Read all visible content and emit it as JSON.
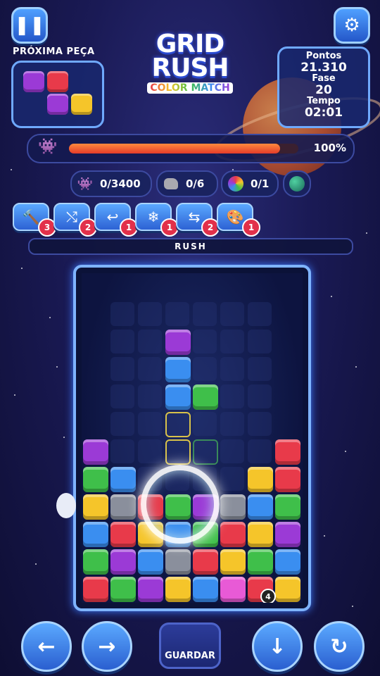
{
  "header": {
    "pause_icon": "pause-icon",
    "settings_icon": "gear-icon",
    "next_piece_label": "PRÓXIMA PEÇA",
    "logo_line1": "GRID",
    "logo_line2": "RUSH",
    "logo_sub": "COLOR MATCH"
  },
  "next_piece": {
    "blocks": [
      {
        "col": 0,
        "row": 0,
        "color": "#9b3ad6"
      },
      {
        "col": 1,
        "row": 0,
        "color": "#e83a4a"
      },
      {
        "col": 1,
        "row": 1,
        "color": "#9b3ad6"
      },
      {
        "col": 2,
        "row": 1,
        "color": "#f5c52a"
      }
    ]
  },
  "score": {
    "points_label": "Pontos",
    "points_value": "21.310",
    "phase_label": "Fase",
    "phase_value": "20",
    "time_label": "Tempo",
    "time_value": "02:01"
  },
  "progress": {
    "icon": "space-invader-icon",
    "value": 0.92,
    "text": "100%"
  },
  "goals": [
    {
      "icon": "space-invader-icon",
      "text": "0/3400"
    },
    {
      "icon": "rock-icon",
      "text": "0/6"
    },
    {
      "icon": "color-wheel-icon",
      "text": "0/1"
    },
    {
      "icon": "planet-icon",
      "text": ""
    }
  ],
  "tools": [
    {
      "icon": "hammer-icon",
      "glyph": "🔨",
      "count": "3"
    },
    {
      "icon": "shuffle-icon",
      "glyph": "⤭",
      "count": "2"
    },
    {
      "icon": "undo-icon",
      "glyph": "↩",
      "count": "1"
    },
    {
      "icon": "snowflake-icon",
      "glyph": "❄",
      "count": "1"
    },
    {
      "icon": "swap-icon",
      "glyph": "⇆",
      "count": "2"
    },
    {
      "icon": "palette-icon",
      "glyph": "🎨",
      "count": "1"
    }
  ],
  "rush_label": "RUSH",
  "board": {
    "colors": {
      "P": "#9b3ad6",
      "B": "#3a8ef0",
      "G": "#3fbf4a",
      "Y": "#f5c52a",
      "R": "#e83a4a",
      "S": "#8a8f9c",
      "M": "#e85ad6"
    },
    "blocks": [
      {
        "c": 3,
        "r": 2,
        "k": "P"
      },
      {
        "c": 3,
        "r": 3,
        "k": "B"
      },
      {
        "c": 3,
        "r": 4,
        "k": "B"
      },
      {
        "c": 4,
        "r": 4,
        "k": "G"
      },
      {
        "c": 0,
        "r": 6,
        "k": "P"
      },
      {
        "c": 7,
        "r": 6,
        "k": "R"
      },
      {
        "c": 0,
        "r": 7,
        "k": "G"
      },
      {
        "c": 1,
        "r": 7,
        "k": "B"
      },
      {
        "c": 6,
        "r": 7,
        "k": "Y"
      },
      {
        "c": 7,
        "r": 7,
        "k": "R"
      },
      {
        "c": 0,
        "r": 8,
        "k": "Y"
      },
      {
        "c": 1,
        "r": 8,
        "k": "S"
      },
      {
        "c": 2,
        "r": 8,
        "k": "R"
      },
      {
        "c": 3,
        "r": 8,
        "k": "G"
      },
      {
        "c": 4,
        "r": 8,
        "k": "P"
      },
      {
        "c": 5,
        "r": 8,
        "k": "S"
      },
      {
        "c": 6,
        "r": 8,
        "k": "B"
      },
      {
        "c": 7,
        "r": 8,
        "k": "G"
      },
      {
        "c": 0,
        "r": 9,
        "k": "B"
      },
      {
        "c": 1,
        "r": 9,
        "k": "R"
      },
      {
        "c": 2,
        "r": 9,
        "k": "Y"
      },
      {
        "c": 3,
        "r": 9,
        "k": "B"
      },
      {
        "c": 4,
        "r": 9,
        "k": "G"
      },
      {
        "c": 5,
        "r": 9,
        "k": "R"
      },
      {
        "c": 6,
        "r": 9,
        "k": "Y"
      },
      {
        "c": 7,
        "r": 9,
        "k": "P"
      },
      {
        "c": 0,
        "r": 10,
        "k": "G"
      },
      {
        "c": 1,
        "r": 10,
        "k": "P"
      },
      {
        "c": 2,
        "r": 10,
        "k": "B"
      },
      {
        "c": 3,
        "r": 10,
        "k": "S"
      },
      {
        "c": 4,
        "r": 10,
        "k": "R"
      },
      {
        "c": 5,
        "r": 10,
        "k": "Y"
      },
      {
        "c": 6,
        "r": 10,
        "k": "G"
      },
      {
        "c": 7,
        "r": 10,
        "k": "B"
      },
      {
        "c": 0,
        "r": 11,
        "k": "R"
      },
      {
        "c": 1,
        "r": 11,
        "k": "G"
      },
      {
        "c": 2,
        "r": 11,
        "k": "P"
      },
      {
        "c": 3,
        "r": 11,
        "k": "Y"
      },
      {
        "c": 4,
        "r": 11,
        "k": "B"
      },
      {
        "c": 5,
        "r": 11,
        "k": "M"
      },
      {
        "c": 6,
        "r": 11,
        "k": "R"
      },
      {
        "c": 7,
        "r": 11,
        "k": "Y"
      }
    ],
    "outlines": [
      {
        "c": 3,
        "r": 5,
        "k": "y"
      },
      {
        "c": 3,
        "r": 6,
        "k": "y"
      },
      {
        "c": 4,
        "r": 6,
        "k": "g"
      }
    ],
    "counter_badge": "4"
  },
  "controls": {
    "left_icon": "arrow-left-icon",
    "right_icon": "arrow-right-icon",
    "save_label": "GUARDAR",
    "down_icon": "arrow-down-icon",
    "rotate_icon": "rotate-icon"
  }
}
